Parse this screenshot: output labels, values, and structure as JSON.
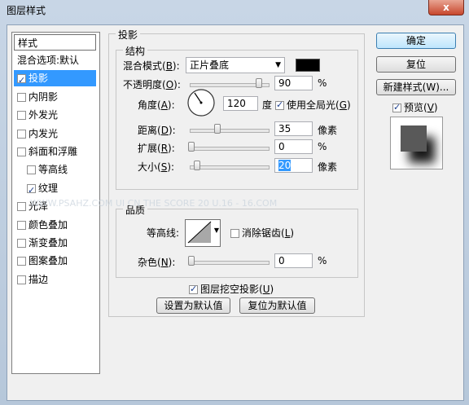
{
  "window": {
    "title": "图层样式",
    "close": "x"
  },
  "list": {
    "header": "样式",
    "items": [
      {
        "label": "混合选项:默认",
        "check": null,
        "checked": false,
        "selected": false,
        "indent": false
      },
      {
        "label": "投影",
        "check": true,
        "checked": true,
        "selected": true,
        "indent": false
      },
      {
        "label": "内阴影",
        "check": true,
        "checked": false,
        "selected": false,
        "indent": false
      },
      {
        "label": "外发光",
        "check": true,
        "checked": false,
        "selected": false,
        "indent": false
      },
      {
        "label": "内发光",
        "check": true,
        "checked": false,
        "selected": false,
        "indent": false
      },
      {
        "label": "斜面和浮雕",
        "check": true,
        "checked": false,
        "selected": false,
        "indent": false
      },
      {
        "label": "等高线",
        "check": true,
        "checked": false,
        "selected": false,
        "indent": true
      },
      {
        "label": "纹理",
        "check": true,
        "checked": true,
        "selected": false,
        "indent": true
      },
      {
        "label": "光泽",
        "check": true,
        "checked": false,
        "selected": false,
        "indent": false
      },
      {
        "label": "颜色叠加",
        "check": true,
        "checked": false,
        "selected": false,
        "indent": false
      },
      {
        "label": "渐变叠加",
        "check": true,
        "checked": false,
        "selected": false,
        "indent": false
      },
      {
        "label": "图案叠加",
        "check": true,
        "checked": false,
        "selected": false,
        "indent": false
      },
      {
        "label": "描边",
        "check": true,
        "checked": false,
        "selected": false,
        "indent": false
      }
    ]
  },
  "drop_shadow": {
    "title": "投影",
    "structure": {
      "title": "结构",
      "blend_mode_label": "混合模式(",
      "blend_mode_key": "B",
      "blend_mode_value": "正片叠底",
      "shadow_color": "#000000",
      "opacity_label": "不透明度(",
      "opacity_key": "O",
      "opacity_value": "90",
      "opacity_fraction": 0.9,
      "percent": "%",
      "angle_label": "角度(",
      "angle_key": "A",
      "angle_value": "120",
      "angle_unit": "度",
      "global_light_label": "使用全局光(",
      "global_light_key": "G",
      "global_light_checked": true,
      "distance_label": "距离(",
      "distance_key": "D",
      "distance_value": "35",
      "distance_fraction": 0.35,
      "pixels": "像素",
      "spread_label": "扩展(",
      "spread_key": "R",
      "spread_value": "0",
      "spread_fraction": 0,
      "size_label": "大小(",
      "size_key": "S",
      "size_value": "20",
      "size_fraction": 0.08
    },
    "quality": {
      "title": "品质",
      "contour_label": "等高线:",
      "antialias_label": "消除锯齿(",
      "antialias_key": "L",
      "noise_label": "杂色(",
      "noise_key": "N",
      "noise_value": "0",
      "noise_fraction": 0
    },
    "knockout_label": "图层挖空投影(",
    "knockout_key": "U",
    "make_default": "设置为默认值",
    "reset_default": "复位为默认值"
  },
  "buttons": {
    "ok": "确定",
    "reset": "复位",
    "new_style": "新建样式(W)...",
    "preview_label": "预览(",
    "preview_key": "V"
  },
  "close_paren": ")",
  "close_paren_colon": "):",
  "watermark": "WWW.PSAHZ.COM  UI  CN  THE SCORE  20 U.16 - 16.COM"
}
